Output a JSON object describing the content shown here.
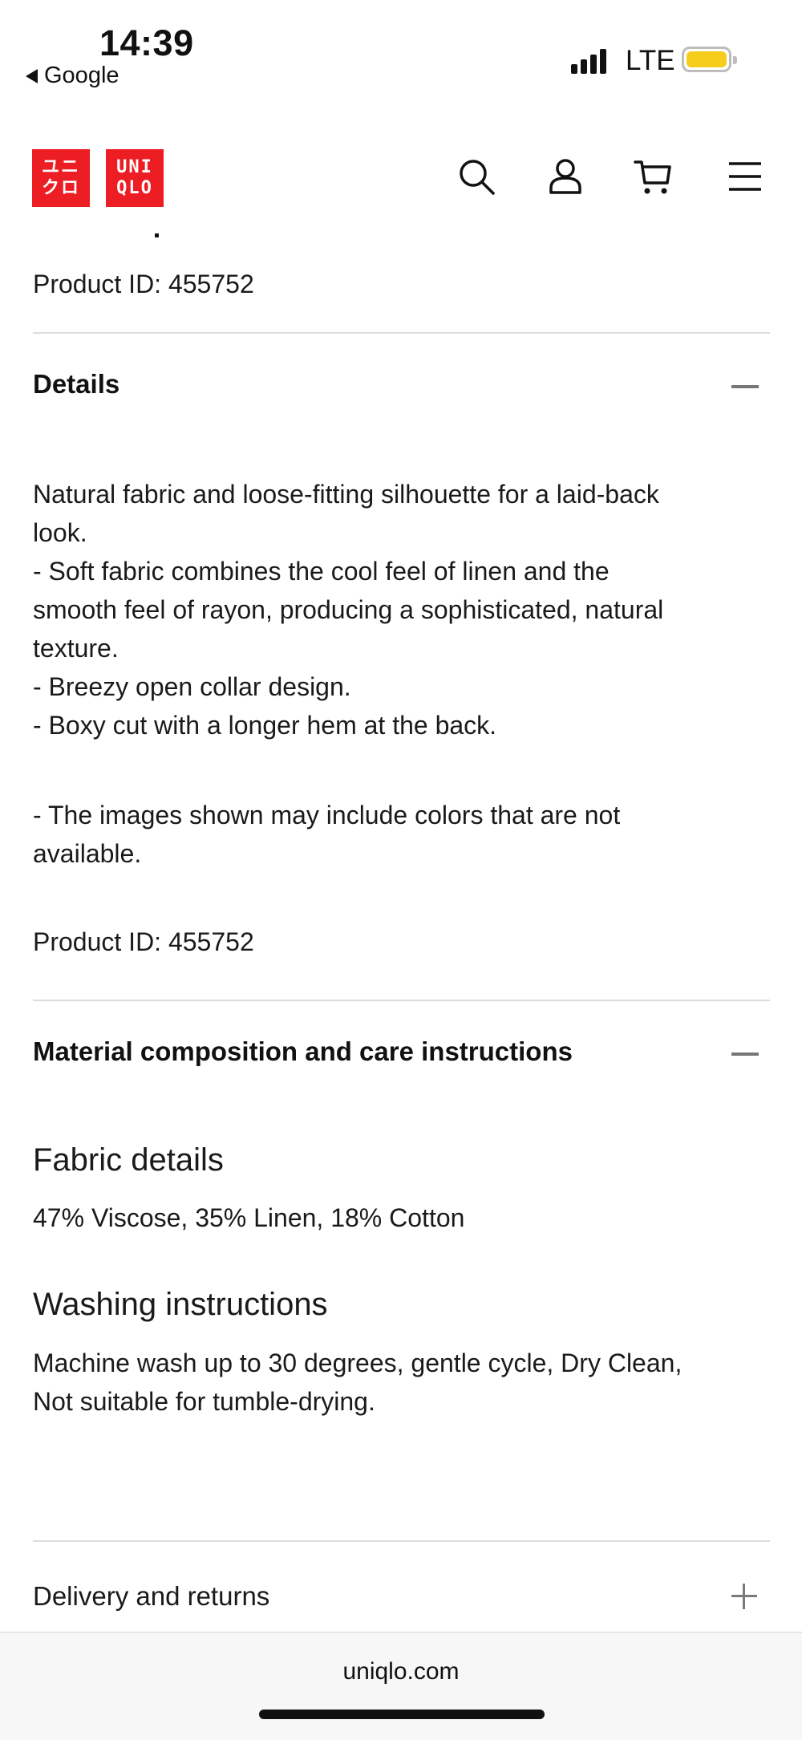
{
  "status_bar": {
    "time": "14:39",
    "back_app": "Google",
    "network": "LTE",
    "battery_color": "#f7cd1b"
  },
  "header": {
    "logo_lines_katakana": [
      "ユニ",
      "クロ"
    ],
    "logo_lines_latin": [
      "UNI",
      "QLO"
    ],
    "brand_color": "#ed1d24",
    "icons": [
      "search-icon",
      "account-icon",
      "cart-icon",
      "menu-icon"
    ]
  },
  "product_top": {
    "product_id": "Product ID: 455752"
  },
  "details": {
    "title": "Details",
    "description": [
      "Natural fabric and loose-fitting silhouette for a laid-back",
      "look.",
      "- Soft fabric combines the cool feel of linen and the",
      "smooth feel of rayon, producing a sophisticated, natural",
      "texture.",
      "- Breezy open collar design.",
      "- Boxy cut with a longer hem at the back."
    ],
    "note": [
      "- The images shown may include colors that are not",
      "available."
    ],
    "product_id": "Product ID: 455752"
  },
  "material": {
    "title": "Material composition and care instructions",
    "fabric_heading": "Fabric details",
    "fabric_value": "47% Viscose, 35% Linen, 18% Cotton",
    "washing_heading": "Washing instructions",
    "washing_value": [
      "Machine wash up to 30 degrees, gentle cycle, Dry Clean,",
      "Not suitable for tumble-drying."
    ]
  },
  "delivery": {
    "title": "Delivery and returns"
  },
  "browser": {
    "url": "uniqlo.com"
  }
}
